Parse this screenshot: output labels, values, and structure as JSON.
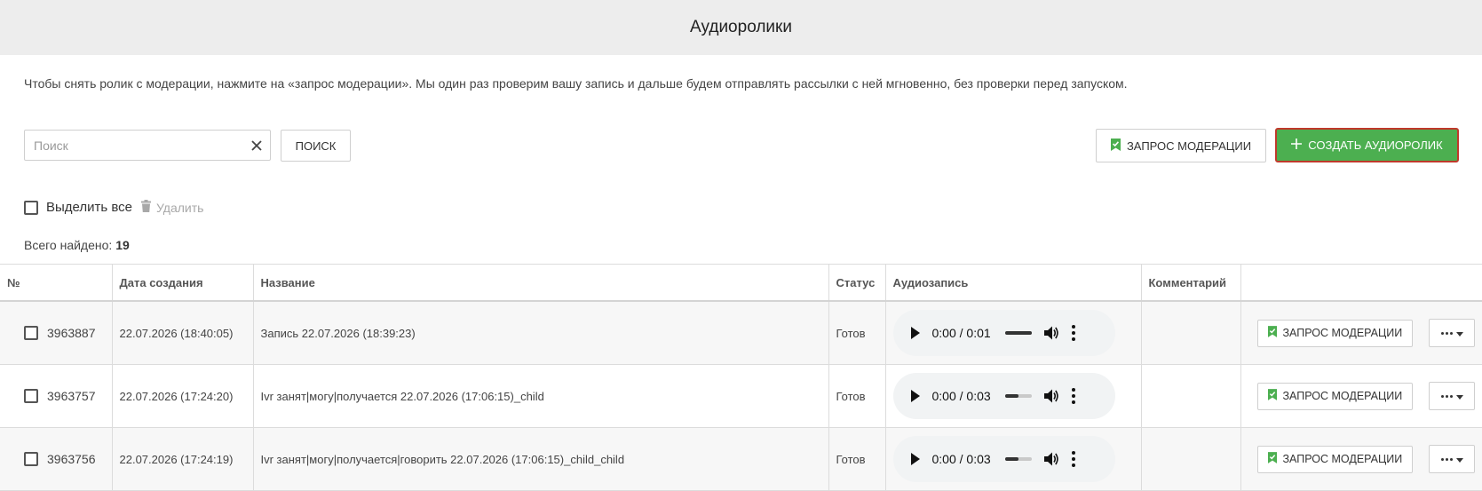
{
  "header": {
    "title": "Аудиоролики"
  },
  "info_text": "Чтобы снять ролик с модерации, нажмите на «запрос модерации». Мы один раз проверим вашу запись и дальше будем отправлять рассылки с ней мгновенно, без проверки перед запуском.",
  "search": {
    "placeholder": "Поиск",
    "value": "",
    "button_label": "Поиск"
  },
  "toolbar": {
    "moderation_label": "Запрос модерации",
    "create_label": "Создать аудиоролик"
  },
  "bulk": {
    "select_all_label": "Выделить все",
    "delete_label": "Удалить"
  },
  "total": {
    "label": "Всего найдено:",
    "count": "19"
  },
  "table": {
    "columns": [
      "№",
      "Дата создания",
      "Название",
      "Статус",
      "Аудиозапись",
      "Комментарий",
      ""
    ],
    "rows": [
      {
        "id": "3963887",
        "date": "22.07.2026 (18:40:05)",
        "name": "Запись 22.07.2026 (18:39:23)",
        "status": "Готов",
        "time": "0:00 / 0:01",
        "volume_level": 1.0,
        "comment": "",
        "action_label": "Запрос модерации"
      },
      {
        "id": "3963757",
        "date": "22.07.2026 (17:24:20)",
        "name": "Ivr занят|могу|получается 22.07.2026 (17:06:15)_child",
        "status": "Готов",
        "time": "0:00 / 0:03",
        "volume_level": 0.5,
        "comment": "",
        "action_label": "Запрос модерации"
      },
      {
        "id": "3963756",
        "date": "22.07.2026 (17:24:19)",
        "name": "Ivr занят|могу|получается|говорить 22.07.2026 (17:06:15)_child_child",
        "status": "Готов",
        "time": "0:00 / 0:03",
        "volume_level": 0.5,
        "comment": "",
        "action_label": "Запрос модерации"
      }
    ]
  },
  "colors": {
    "accent_green": "#4caf50",
    "header_bg": "#ededed",
    "create_border": "#c0392b"
  },
  "icons": {
    "moderation": "bookmark-check-icon",
    "create": "plus-icon",
    "clear": "close-icon",
    "delete": "trash-icon",
    "more": "ellipsis-icon",
    "dropdown": "caret-down-icon"
  }
}
